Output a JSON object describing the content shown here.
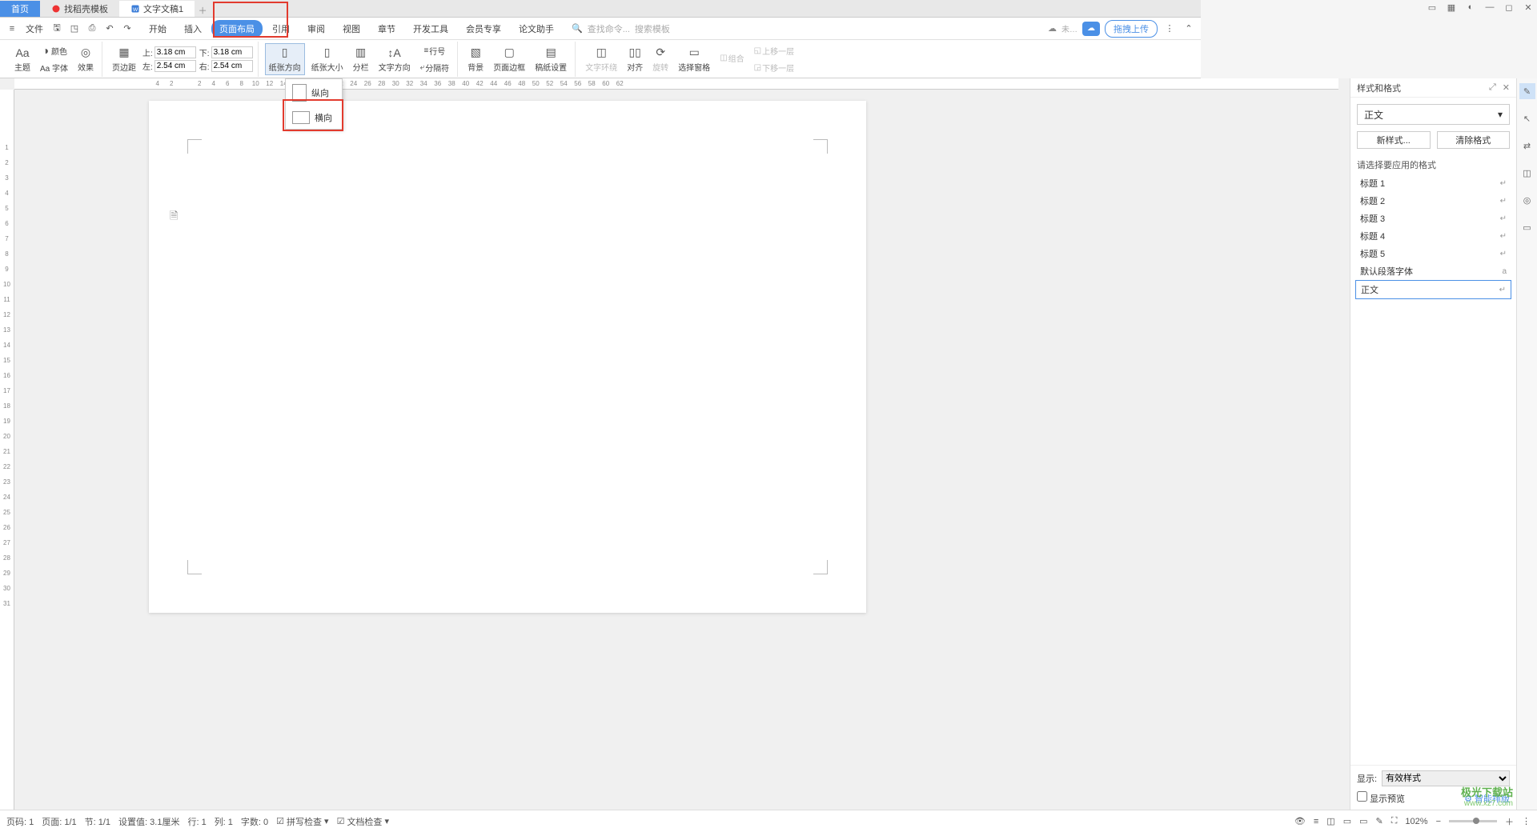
{
  "tabs": {
    "home": "首页",
    "template": "找稻壳模板",
    "doc": "文字文稿1"
  },
  "menu": {
    "file": "文件",
    "items": [
      "开始",
      "插入",
      "页面布局",
      "引用",
      "审阅",
      "视图",
      "章节",
      "开发工具",
      "会员专享",
      "论文助手"
    ],
    "active_index": 2,
    "search_cmd": "查找命令...",
    "search_tpl": "搜索模板",
    "not_saved": "未…",
    "upload": "拖拽上传"
  },
  "ribbon": {
    "theme": "主题",
    "color": "颜色",
    "font": "字体",
    "effect": "效果",
    "margin": "页边距",
    "top": "上:",
    "bottom": "下:",
    "left": "左:",
    "right_m": "右:",
    "val_tb": "3.18 cm",
    "val_lr": "2.54 cm",
    "orientation": "纸张方向",
    "size": "纸张大小",
    "columns": "分栏",
    "text_dir": "文字方向",
    "line_num": "行号",
    "breaks": "分隔符",
    "background": "背景",
    "border": "页面边框",
    "watermark_set": "稿纸设置",
    "text_wrap": "文字环绕",
    "align": "对齐",
    "rotate": "旋转",
    "sel_pane": "选择窗格",
    "group": "组合",
    "bring_fwd": "上移一层",
    "send_back": "下移一层"
  },
  "orient_menu": {
    "portrait": "纵向",
    "landscape": "横向"
  },
  "style_panel": {
    "title": "样式和格式",
    "current": "正文",
    "new_style": "新样式...",
    "clear": "清除格式",
    "prompt": "请选择要应用的格式",
    "items": [
      "标题 1",
      "标题 2",
      "标题 3",
      "标题 4",
      "标题 5",
      "默认段落字体",
      "正文"
    ],
    "selected_index": 6,
    "show_label": "显示:",
    "show_value": "有效样式",
    "preview": "显示预览",
    "smart": "智能排版"
  },
  "status": {
    "page_num": "页码: 1",
    "page": "页面: 1/1",
    "section": "节: 1/1",
    "set_val": "设置值: 3.1厘米",
    "line": "行: 1",
    "col": "列: 1",
    "chars": "字数: 0",
    "spell": "拼写检查",
    "doc_check": "文档检查",
    "zoom": "102%"
  },
  "ruler_h": [
    "4",
    "2",
    "",
    "2",
    "4",
    "6",
    "8",
    "10",
    "12",
    "14",
    "16",
    "18",
    "20",
    "22",
    "24",
    "26",
    "28",
    "30",
    "32",
    "34",
    "36",
    "38",
    "40",
    "42",
    "44",
    "46",
    "48",
    "50",
    "52",
    "54",
    "56",
    "58",
    "60",
    "62"
  ],
  "ruler_v": [
    "",
    "",
    "1",
    "2",
    "3",
    "4",
    "5",
    "6",
    "7",
    "8",
    "9",
    "10",
    "11",
    "12",
    "13",
    "14",
    "15",
    "16",
    "17",
    "18",
    "19",
    "20",
    "21",
    "22",
    "23",
    "24",
    "25",
    "26",
    "27",
    "28",
    "29",
    "30",
    "31"
  ],
  "watermark": {
    "line1": "极光下载站",
    "line2": "www.xz7.com"
  }
}
